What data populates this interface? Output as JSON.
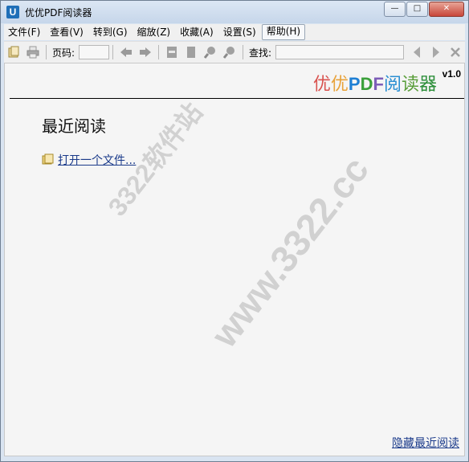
{
  "window": {
    "title": "优优PDF阅读器",
    "app_icon_letter": "U",
    "minimize": "—",
    "maximize": "□",
    "close": "✕"
  },
  "menu": [
    {
      "label": "文件(F)"
    },
    {
      "label": "查看(V)"
    },
    {
      "label": "转到(G)"
    },
    {
      "label": "缩放(Z)"
    },
    {
      "label": "收藏(A)"
    },
    {
      "label": "设置(S)"
    },
    {
      "label": "帮助(H)"
    }
  ],
  "toolbar": {
    "page_label": "页码:",
    "page_value": "",
    "find_label": "查找:",
    "find_value": ""
  },
  "logo": {
    "part1": "优",
    "part2": "优",
    "p": "P",
    "d": "D",
    "f": "F",
    "part6": "阅",
    "part7": "读",
    "part8": "器",
    "version": "v1.0"
  },
  "main": {
    "recent_title": "最近阅读",
    "open_file": "打开一个文件...",
    "hide_recent": "隐藏最近阅读"
  },
  "watermark": {
    "text1": "3322软件站",
    "text2": "www.3322.cc"
  }
}
